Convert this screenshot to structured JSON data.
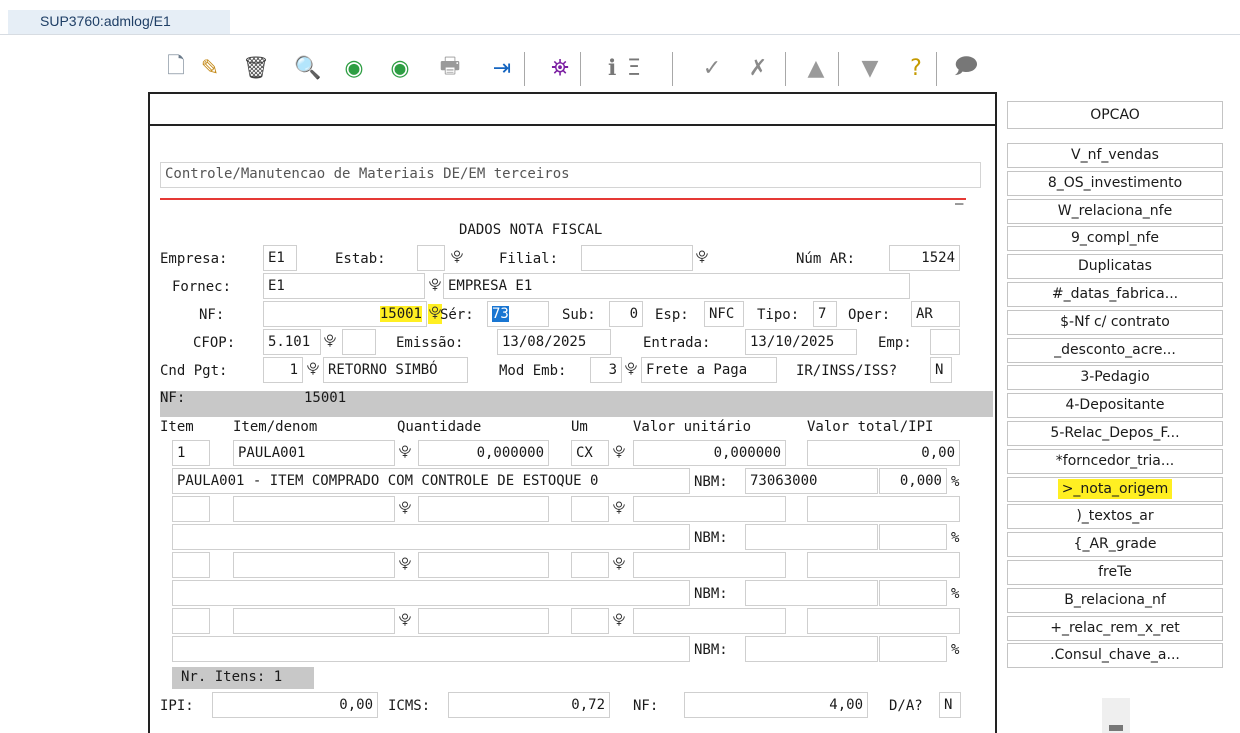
{
  "tab": {
    "label": "SUP3760:admlog/E1"
  },
  "toolbar": [
    {
      "name": "new-doc-icon",
      "glyph": "🗋",
      "color": "#6a7a8a"
    },
    {
      "name": "edit-icon",
      "glyph": "✎",
      "color": "#c58b1b"
    },
    {
      "name": "trash-icon",
      "glyph": "🗑",
      "color": "#444444"
    },
    {
      "name": "search-icon",
      "glyph": "🔍",
      "color": "#2b5fa5"
    },
    {
      "name": "previous-icon",
      "glyph": "◉",
      "color": "#2e9e43"
    },
    {
      "name": "next-icon",
      "glyph": "◉",
      "color": "#2e9e43"
    },
    {
      "name": "print-icon",
      "glyph": "🖶",
      "color": "#9a9a9a"
    },
    {
      "name": "exit-icon",
      "glyph": "⇥",
      "color": "#1565c0"
    },
    {
      "name": "binoculars-icon",
      "glyph": "⛯",
      "color": "#7b1fa2"
    },
    {
      "name": "info-icon",
      "glyph": "ℹ",
      "color": "#777777"
    },
    {
      "name": "list-icon",
      "glyph": "Ξ",
      "color": "#777777"
    },
    {
      "name": "confirm-icon",
      "glyph": "✓",
      "color": "#8a8a8a"
    },
    {
      "name": "cancel-icon",
      "glyph": "✗",
      "color": "#8a8a8a"
    },
    {
      "name": "up-icon",
      "glyph": "▲",
      "color": "#9a9a9a"
    },
    {
      "name": "down-icon",
      "glyph": "▼",
      "color": "#9a9a9a"
    },
    {
      "name": "help-icon",
      "glyph": "?",
      "color": "#c49a00"
    },
    {
      "name": "comment-icon",
      "glyph": "🗩",
      "color": "#777777"
    }
  ],
  "form": {
    "title": "Controle/Manutencao de Materiais DE/EM terceiros",
    "section_title": "DADOS NOTA FISCAL",
    "empresa_label": "Empresa:",
    "empresa": "E1",
    "estab_label": "Estab:",
    "estab": "",
    "filial_label": "Filial:",
    "filial": "",
    "num_ar_label": "Núm AR:",
    "num_ar": "1524",
    "fornec_label": "Fornec:",
    "fornec": "E1",
    "fornec_name": "EMPRESA E1",
    "nf_label": "NF:",
    "nf": "15001",
    "ser_label": "Sér:",
    "ser": "73",
    "sub_label": "Sub:",
    "sub": "0",
    "esp_label": "Esp:",
    "esp": "NFC",
    "tipo_label": "Tipo:",
    "tipo": "7",
    "oper_label": "Oper:",
    "oper": "AR",
    "cfop_label": "CFOP:",
    "cfop": "5.101",
    "emissao_label": "Emissão:",
    "emissao": "13/08/2025",
    "entrada_label": "Entrada:",
    "entrada": "13/10/2025",
    "emp_label": "Emp:",
    "emp": "",
    "cnd_label": "Cnd Pgt:",
    "cnd": "1",
    "cnd_desc": "RETORNO SIMBÓ",
    "modemb_label": "Mod Emb:",
    "modemb": "3",
    "modemb_desc": "Frete a Paga",
    "irinss_label": "IR/INSS/ISS?",
    "irinss": "N",
    "nf_bar_label": "NF:",
    "nf_bar_value": "15001"
  },
  "items": {
    "headers": {
      "item": "Item",
      "denom": "Item/denom",
      "qtd": "Quantidade",
      "um": "Um",
      "vunit": "Valor unitário",
      "vtotal": "Valor total/IPI"
    },
    "row1": {
      "item": "1",
      "code": "PAULA001",
      "qtd": "0,000000",
      "um": "CX",
      "vunit": "0,000000",
      "vtotal": "0,00",
      "desc": "PAULA001 - ITEM COMPRADO COM CONTROLE DE ESTOQUE 0",
      "nbm_label": "NBM:",
      "nbm": "73063000",
      "pct": "0,000",
      "pct_sign": "%"
    },
    "nbm_label": "NBM:",
    "pct_sign": "%",
    "nr_itens": "Nr. Itens: 1"
  },
  "totals": {
    "ipi_label": "IPI:",
    "ipi": "0,00",
    "icms_label": "ICMS:",
    "icms": "0,72",
    "nf_label": "NF:",
    "nf": "4,00",
    "da_label": "D/A?",
    "da": "N"
  },
  "options": {
    "header": "OPCAO",
    "items": [
      "V_nf_vendas",
      "8_OS_investimento",
      "W_relaciona_nfe",
      "9_compl_nfe",
      "Duplicatas",
      "#_datas_fabrica...",
      "$-Nf c/ contrato",
      "_desconto_acre...",
      "3-Pedagio",
      "4-Depositante",
      "5-Relac_Depos_F...",
      "*forncedor_tria...",
      ">_nota_origem",
      ")_textos_ar",
      "{_AR_grade",
      "freTe",
      "B_relaciona_nf",
      "+_relac_rem_x_ret",
      ".Consul_chave_a..."
    ],
    "highlighted": ">_nota_origem"
  },
  "colors": {
    "highlight": "#ffef22",
    "selection": "#1976d2",
    "redline": "#e53935"
  }
}
